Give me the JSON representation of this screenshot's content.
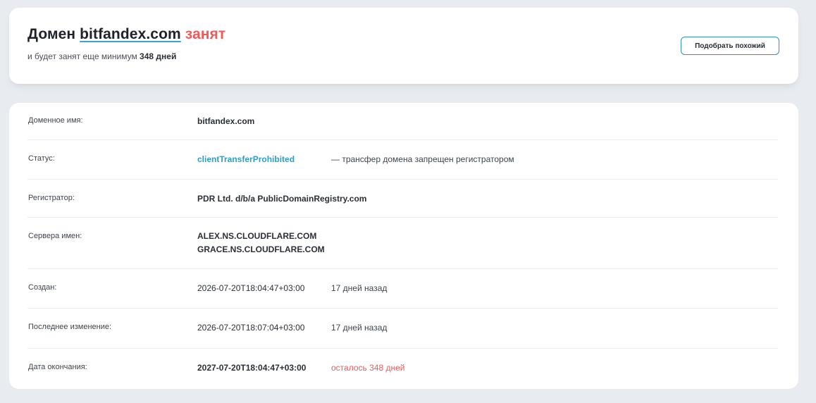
{
  "header": {
    "prefix": "Домен",
    "domain": "bitfandex.com",
    "status_word": "занят",
    "subtitle_prefix": "и будет занят еще минимум",
    "subtitle_days": "348 дней",
    "similar_button": "Подобрать похожий"
  },
  "details": {
    "domain_name": {
      "label": "Доменное имя:",
      "value": "bitfandex.com"
    },
    "status": {
      "label": "Статус:",
      "value": "clientTransferProhibited",
      "note": "— трансфер домена запрещен регистратором"
    },
    "registrar": {
      "label": "Регистратор:",
      "value": "PDR Ltd. d/b/a PublicDomainRegistry.com"
    },
    "nameservers": {
      "label": "Сервера имен:",
      "values": [
        "ALEX.NS.CLOUDFLARE.COM",
        "GRACE.NS.CLOUDFLARE.COM"
      ]
    },
    "created": {
      "label": "Создан:",
      "value": "2026-07-20T18:04:47+03:00",
      "note": "17 дней назад"
    },
    "updated": {
      "label": "Последнее изменение:",
      "value": "2026-07-20T18:07:04+03:00",
      "note": "17 дней назад"
    },
    "expires": {
      "label": "Дата окончания:",
      "value": "2027-07-20T18:04:47+03:00",
      "note": "осталось 348 дней"
    }
  },
  "colors": {
    "accent": "#2e9fc4",
    "danger": "#f05a5a",
    "background": "#e8ecf0"
  }
}
